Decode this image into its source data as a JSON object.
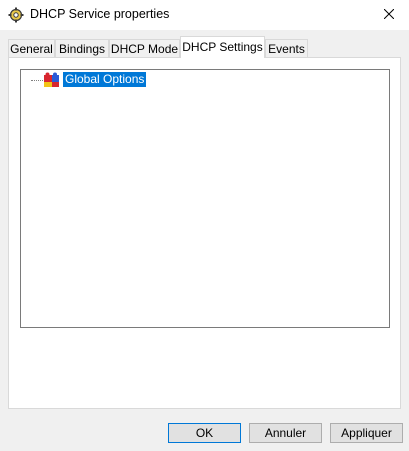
{
  "window": {
    "title": "DHCP Service properties"
  },
  "tabs": [
    {
      "label": "General"
    },
    {
      "label": "Bindings"
    },
    {
      "label": "DHCP Mode"
    },
    {
      "label": "DHCP Settings"
    },
    {
      "label": "Events"
    }
  ],
  "active_tab": "DHCP Settings",
  "tree": {
    "items": [
      {
        "label": "Global Options",
        "selected": true
      }
    ]
  },
  "buttons": {
    "ok": "OK",
    "cancel": "Annuler",
    "apply": "Appliquer"
  },
  "colors": {
    "selection": "#0078d7",
    "window_bg": "#f0f0f0"
  },
  "icons": {
    "app": "gear-icon",
    "close": "close-icon",
    "tree_item": "puzzle-icon"
  }
}
